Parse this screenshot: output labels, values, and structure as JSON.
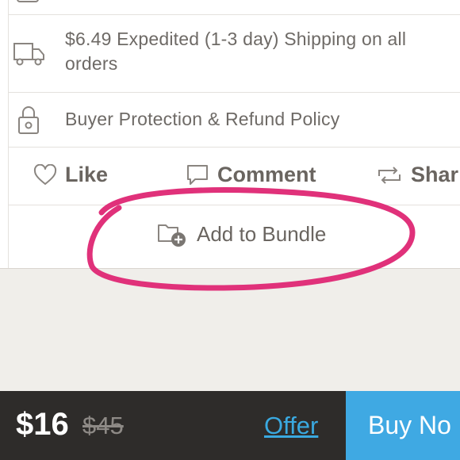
{
  "info_rows": {
    "shipping_text": "$6.49 Expedited (1-3 day) Shipping on all orders",
    "protection_text": "Buyer Protection & Refund Policy"
  },
  "actions": {
    "like_label": "Like",
    "comment_label": "Comment",
    "share_label": "Shar"
  },
  "bundle": {
    "label": "Add to Bundle"
  },
  "bottom_bar": {
    "price": "$16",
    "original_price": "$45",
    "offer_label": "Offer",
    "buy_label": "Buy No"
  },
  "colors": {
    "highlight_circle": "#e0317a",
    "buy_button": "#3fa9e3",
    "offer_link": "#3aa9e0",
    "bottom_bar": "#2e2c2a"
  },
  "icons": [
    "truck-icon",
    "lock-icon",
    "heart-icon",
    "comment-icon",
    "share-icon",
    "bundle-icon"
  ]
}
